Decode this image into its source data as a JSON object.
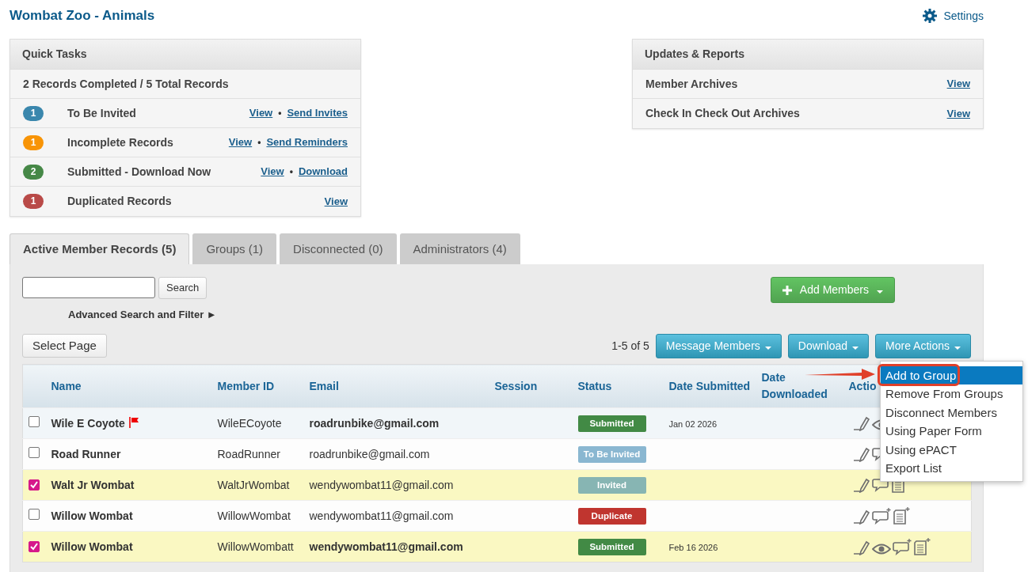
{
  "page": {
    "title": "Wombat Zoo - Animals",
    "settings_label": "Settings"
  },
  "quick_tasks": {
    "title": "Quick Tasks",
    "summary": "2 Records Completed / 5 Total Records",
    "items": [
      {
        "count": "1",
        "color": "#3a87ad",
        "label": "To Be Invited",
        "links": [
          "View",
          "Send Invites"
        ],
        "separator": "•"
      },
      {
        "count": "1",
        "color": "#f89406",
        "label": "Incomplete Records",
        "links": [
          "View",
          "Send Reminders"
        ],
        "separator": "•"
      },
      {
        "count": "2",
        "color": "#468847",
        "label": "Submitted - Download Now",
        "links": [
          "View",
          "Download"
        ],
        "separator": "•"
      },
      {
        "count": "1",
        "color": "#b94a48",
        "label": "Duplicated Records",
        "links": [
          "View"
        ]
      }
    ]
  },
  "updates": {
    "title": "Updates & Reports",
    "items": [
      {
        "label": "Member Archives",
        "link": "View"
      },
      {
        "label": "Check In Check Out Archives",
        "link": "View"
      }
    ]
  },
  "tabs": [
    {
      "label": "Active Member Records (5)",
      "selected": true
    },
    {
      "label": "Groups (1)",
      "selected": false
    },
    {
      "label": "Disconnected (0)",
      "selected": false
    },
    {
      "label": "Administrators (4)",
      "selected": false
    }
  ],
  "toolbar": {
    "search_button": "Search",
    "advanced_link": "Advanced Search and Filter ►",
    "add_members": "Add Members",
    "select_page": "Select Page",
    "pager": "1-5 of 5",
    "buttons": [
      "Message Members",
      "Download",
      "More Actions"
    ]
  },
  "more_actions_menu": {
    "items": [
      {
        "label": "Add to Group",
        "selected": true
      },
      {
        "label": "Remove From Groups",
        "selected": false
      },
      {
        "label": "Disconnect Members",
        "selected": false
      },
      {
        "label": "Using Paper Form",
        "selected": false
      },
      {
        "label": "Using ePACT",
        "selected": false
      },
      {
        "label": "Export List",
        "selected": false
      }
    ]
  },
  "table": {
    "columns": [
      "Name",
      "Member ID",
      "Email",
      "Session",
      "Status",
      "Date Submitted",
      "Date Downloaded",
      "Actio"
    ],
    "rows": [
      {
        "selected": false,
        "highlighted": true,
        "flagged": true,
        "emphasized": true,
        "name": "Wile E Coyote",
        "member_id": "WileECoyote",
        "email": "roadrunbike@gmail.com",
        "status": {
          "label": "Submitted",
          "kind": "submitted"
        },
        "date_submitted": "Jan 02 2026",
        "actions": [
          {
            "kind": "edit"
          },
          {
            "kind": "view"
          }
        ]
      },
      {
        "selected": false,
        "highlighted": false,
        "flagged": false,
        "emphasized": false,
        "name": "Road Runner",
        "member_id": "RoadRunner",
        "email": "roadrunbike@gmail.com",
        "status": {
          "label": "To Be Invited",
          "kind": "to_be_invited"
        },
        "actions": [
          {
            "kind": "edit"
          },
          {
            "kind": "comment"
          }
        ]
      },
      {
        "selected": true,
        "highlighted": false,
        "flagged": false,
        "emphasized": false,
        "name": "Walt Jr Wombat",
        "member_id": "WaltJrWombat",
        "email": "wendywombat11@gmail.com",
        "status": {
          "label": "Invited",
          "kind": "invited"
        },
        "actions": [
          {
            "kind": "edit"
          },
          {
            "kind": "comment"
          },
          {
            "kind": "form"
          }
        ]
      },
      {
        "selected": false,
        "highlighted": false,
        "flagged": false,
        "emphasized": false,
        "name": "Willow Wombat",
        "member_id": "WillowWombat",
        "email": "wendywombat11@gmail.com",
        "status": {
          "label": "Duplicate",
          "kind": "duplicate"
        },
        "actions": [
          {
            "kind": "edit"
          },
          {
            "kind": "comment_add"
          },
          {
            "kind": "form_add"
          }
        ]
      },
      {
        "selected": true,
        "highlighted": false,
        "flagged": false,
        "emphasized": true,
        "name": "Willow Wombat",
        "member_id": "WillowWombatt",
        "email": "wendywombat11@gmail.com",
        "status": {
          "label": "Submitted",
          "kind": "submitted"
        },
        "date_submitted": "Feb 16 2026",
        "actions": [
          {
            "kind": "edit"
          },
          {
            "kind": "view"
          },
          {
            "kind": "comment_add"
          },
          {
            "kind": "form_add"
          }
        ]
      }
    ]
  }
}
